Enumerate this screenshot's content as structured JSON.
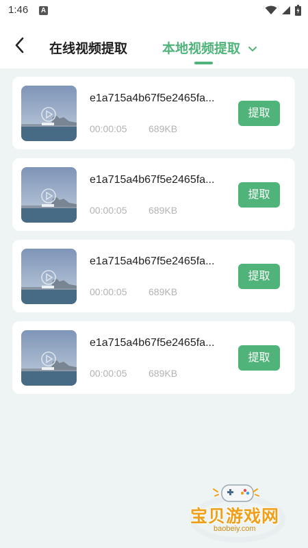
{
  "status_bar": {
    "time": "1:46",
    "notification_letter": "A",
    "icons": [
      "notification-a-icon",
      "wifi-icon",
      "signal-icon",
      "battery-icon"
    ]
  },
  "header": {
    "tabs": [
      {
        "label": "在线视频提取",
        "active": false
      },
      {
        "label": "本地视频提取",
        "active": true
      }
    ],
    "accent_color": "#4fb37a"
  },
  "videos": [
    {
      "name": "e1a715a4b67f5e2465fa...",
      "duration": "00:00:05",
      "size": "689KB",
      "action": "提取"
    },
    {
      "name": "e1a715a4b67f5e2465fa...",
      "duration": "00:00:05",
      "size": "689KB",
      "action": "提取"
    },
    {
      "name": "e1a715a4b67f5e2465fa...",
      "duration": "00:00:05",
      "size": "689KB",
      "action": "提取"
    },
    {
      "name": "e1a715a4b67f5e2465fa...",
      "duration": "00:00:05",
      "size": "689KB",
      "action": "提取"
    }
  ],
  "watermark": {
    "text": "宝贝游戏网",
    "url": "baobeiy.com"
  }
}
